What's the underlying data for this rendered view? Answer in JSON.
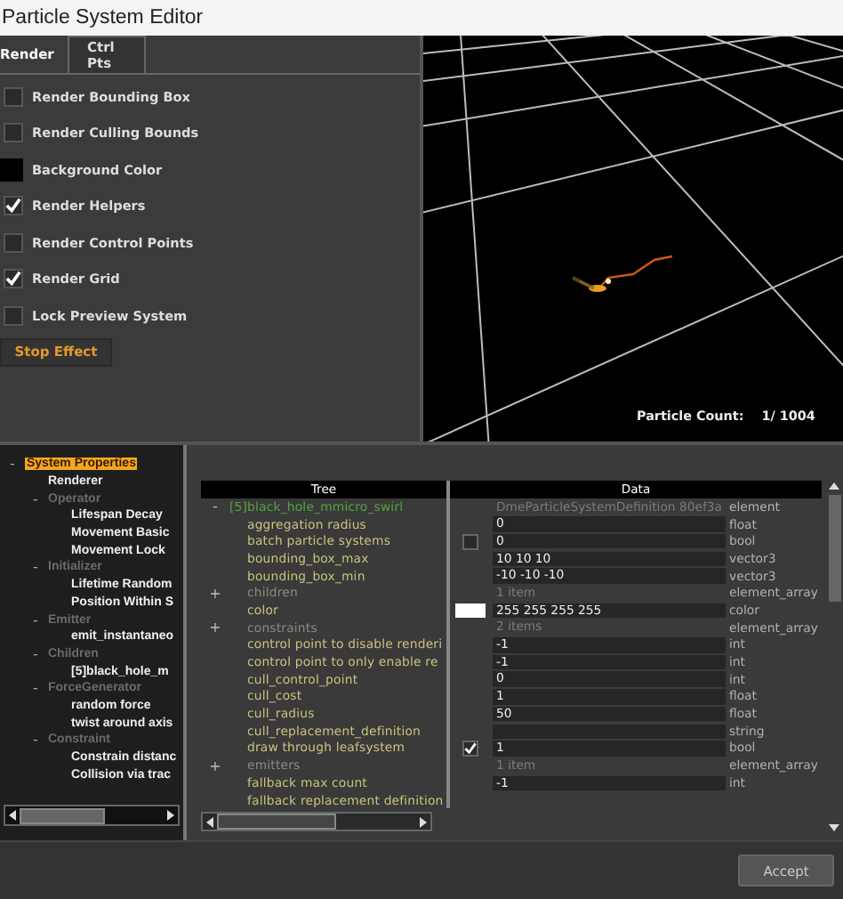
{
  "window": {
    "title": "Particle System Editor"
  },
  "render_panel": {
    "tabs": [
      {
        "label": "Render",
        "selected": true
      },
      {
        "label": "Ctrl Pts",
        "selected": false
      }
    ],
    "options": [
      {
        "kind": "checkbox",
        "label": "Render Bounding Box",
        "checked": false
      },
      {
        "kind": "checkbox",
        "label": "Render Culling Bounds",
        "checked": false
      },
      {
        "kind": "color",
        "label": "Background Color",
        "color": "#000000"
      },
      {
        "kind": "checkbox",
        "label": "Render Helpers",
        "checked": true
      },
      {
        "kind": "checkbox",
        "label": "Render Control Points",
        "checked": false
      },
      {
        "kind": "checkbox",
        "label": "Render Grid",
        "checked": true
      },
      {
        "kind": "checkbox",
        "label": "Lock Preview System",
        "checked": false
      }
    ],
    "stop_button": "Stop Effect"
  },
  "viewport": {
    "particle_count_label": "Particle Count:",
    "particle_count": "1/ 1004"
  },
  "system_tree": [
    {
      "label": "System Properties",
      "toggle": "-",
      "selected": true,
      "children": [
        {
          "label": "Renderer",
          "selected": false
        },
        {
          "label": "Operator",
          "toggle": "-",
          "selected": false,
          "children": [
            {
              "label": "Lifespan Decay",
              "selected": false
            },
            {
              "label": "Movement Basic",
              "selected": false
            },
            {
              "label": "Movement Lock",
              "selected": false
            }
          ]
        },
        {
          "label": "Initializer",
          "toggle": "-",
          "selected": false,
          "children": [
            {
              "label": "Lifetime Random",
              "selected": false
            },
            {
              "label": "Position Within S",
              "selected": false
            }
          ]
        },
        {
          "label": "Emitter",
          "toggle": "-",
          "selected": false,
          "children": [
            {
              "label": "emit_instantaneo",
              "selected": false
            }
          ]
        },
        {
          "label": "Children",
          "toggle": "-",
          "selected": false,
          "children": [
            {
              "label": "[5]black_hole_m",
              "selected": false
            }
          ]
        },
        {
          "label": "ForceGenerator",
          "toggle": "-",
          "selected": false,
          "children": [
            {
              "label": "random force",
              "selected": false
            },
            {
              "label": "twist around axis",
              "selected": false
            }
          ]
        },
        {
          "label": "Constraint",
          "toggle": "-",
          "selected": false,
          "children": [
            {
              "label": "Constrain distanc",
              "selected": false
            },
            {
              "label": "Collision via trac",
              "selected": false
            }
          ]
        }
      ]
    }
  ],
  "property_table": {
    "columns": [
      "Tree",
      "Data"
    ],
    "rows": [
      {
        "kind": "element",
        "toggle": "-",
        "name": "[5]black_hole_mmicro_swirl",
        "summary": "DmeParticleSystemDefinition 80ef3a",
        "type": "element"
      },
      {
        "kind": "property",
        "name": "aggregation radius",
        "value": "0",
        "type": "float"
      },
      {
        "kind": "property",
        "name": "batch particle systems",
        "checked": false,
        "value": "0",
        "type": "bool"
      },
      {
        "kind": "property",
        "name": "bounding_box_max",
        "value": "10 10 10",
        "type": "vector3"
      },
      {
        "kind": "property",
        "name": "bounding_box_min",
        "value": "-10 -10 -10",
        "type": "vector3"
      },
      {
        "kind": "array",
        "toggle": "+",
        "name": "children",
        "summary": "1 item",
        "type": "element_array"
      },
      {
        "kind": "property",
        "name": "color",
        "color": "#ffffff",
        "value": "255 255 255 255",
        "type": "color"
      },
      {
        "kind": "array",
        "toggle": "+",
        "name": "constraints",
        "summary": "2 items",
        "type": "element_array"
      },
      {
        "kind": "property",
        "name": "control point to disable renderi",
        "value": "-1",
        "type": "int"
      },
      {
        "kind": "property",
        "name": "control point to only enable re",
        "value": "-1",
        "type": "int"
      },
      {
        "kind": "property",
        "name": "cull_control_point",
        "value": "0",
        "type": "int"
      },
      {
        "kind": "property",
        "name": "cull_cost",
        "value": "1",
        "type": "float"
      },
      {
        "kind": "property",
        "name": "cull_radius",
        "value": "50",
        "type": "float"
      },
      {
        "kind": "property",
        "name": "cull_replacement_definition",
        "type": "string"
      },
      {
        "kind": "property",
        "name": "draw through leafsystem",
        "checked": true,
        "value": "1",
        "type": "bool"
      },
      {
        "kind": "array",
        "toggle": "+",
        "name": "emitters",
        "summary": "1 item",
        "type": "element_array"
      },
      {
        "kind": "property",
        "name": "fallback max count",
        "value": "-1",
        "type": "int"
      },
      {
        "kind": "property",
        "name": "fallback replacement definition"
      }
    ]
  },
  "footer": {
    "accept_button": "Accept"
  }
}
